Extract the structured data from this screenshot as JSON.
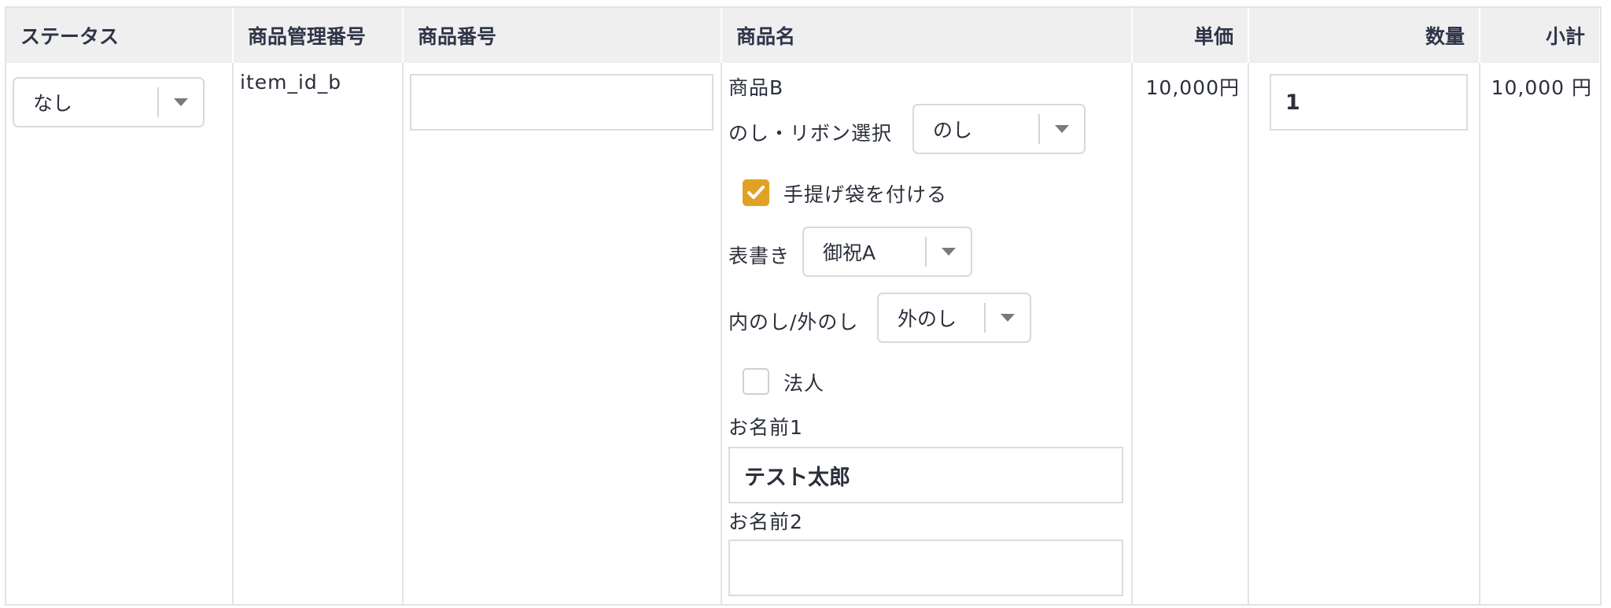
{
  "table": {
    "headers": {
      "status": "ステータス",
      "item_mgmt_no": "商品管理番号",
      "item_no": "商品番号",
      "item_name": "商品名",
      "unit_price": "単価",
      "quantity": "数量",
      "subtotal": "小計"
    },
    "row": {
      "status_select": {
        "value": "なし",
        "icon": "chevron-down-icon"
      },
      "item_mgmt_no": "item_id_b",
      "item_no_input": {
        "value": ""
      },
      "item_name": "商品B",
      "noshi_ribbon": {
        "label": "のし・リボン選択",
        "value": "のし"
      },
      "tote_bag": {
        "label": "手提げ袋を付ける",
        "checked": true
      },
      "omotegaki": {
        "label": "表書き",
        "value": "御祝A"
      },
      "uchi_soto": {
        "label": "内のし/外のし",
        "value": "外のし"
      },
      "corporate": {
        "label": "法人",
        "checked": false
      },
      "name1": {
        "label": "お名前1",
        "value": "テスト太郎"
      },
      "name2": {
        "label": "お名前2",
        "value": ""
      },
      "unit_price": "10,000円",
      "quantity_input": {
        "value": "1"
      },
      "subtotal": "10,000 円"
    }
  },
  "colors": {
    "header_bg": "#efefef",
    "border": "#e3e3e3",
    "checkbox_accent": "#e0a224",
    "text": "#2b2f3a"
  }
}
